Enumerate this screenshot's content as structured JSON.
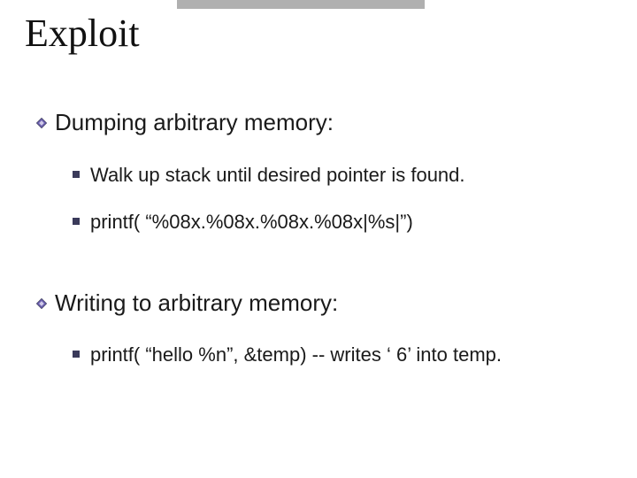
{
  "title": "Exploit",
  "sections": [
    {
      "heading": "Dumping arbitrary memory:",
      "items": [
        "Walk up stack until desired pointer is found.",
        "printf( “%08x.%08x.%08x.%08x|%s|”)"
      ]
    },
    {
      "heading": "Writing to arbitrary memory:",
      "items": [
        "printf( “hello %n”, &temp)   --  writes ‘ 6’ into temp."
      ]
    }
  ],
  "colors": {
    "accent": "#6b5fae",
    "text": "#1a1a1a",
    "header_bar": "#b0b0b0"
  }
}
